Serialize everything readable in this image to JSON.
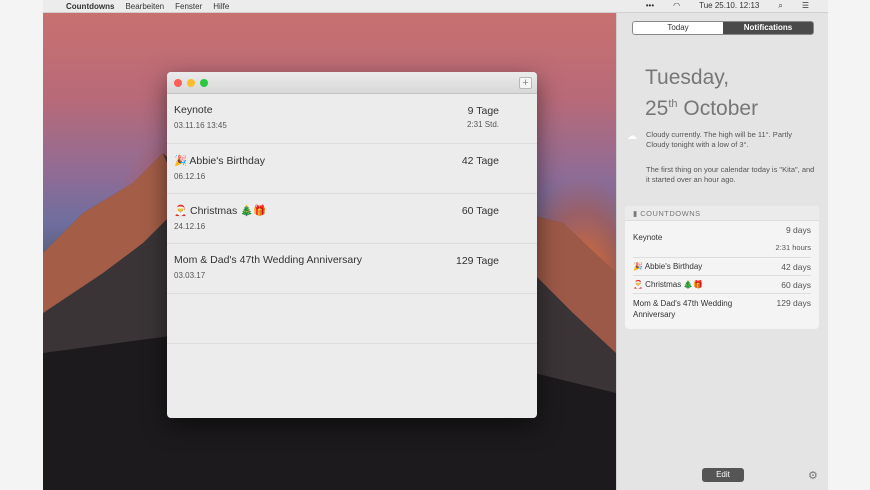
{
  "menubar": {
    "app": "Countdowns",
    "items": [
      "Bearbeiten",
      "Fenster",
      "Hilfe"
    ],
    "clock": "Tue 25.10. 12:13"
  },
  "window": {
    "rows": [
      {
        "title": "Keynote",
        "date": "03.11.16 13:45",
        "value": "9 Tage",
        "sub": "2:31 Std."
      },
      {
        "title": "🎉 Abbie's Birthday",
        "date": "06.12.16",
        "value": "42 Tage"
      },
      {
        "title": "🎅 Christmas 🎄🎁",
        "date": "24.12.16",
        "value": "60 Tage"
      },
      {
        "title": "Mom & Dad's 47th Wedding Anniversary",
        "date": "03.03.17",
        "value": "129 Tage"
      }
    ]
  },
  "nc": {
    "tabs": [
      "Today",
      "Notifications"
    ],
    "weekday": "Tuesday,",
    "date_num": "25",
    "date_sup": "th",
    "month": "October",
    "weather": "Cloudy currently. The high will be 11°. Partly Cloudy tonight with a low of 3°.",
    "calendar": "The first thing on your calendar today is \"Kita\", and it started over an hour ago.",
    "widget_title": "COUNTDOWNS",
    "widget_rows": [
      {
        "title": "Keynote",
        "value": "9 days",
        "sub": "2:31 hours"
      },
      {
        "title": "🎉 Abbie's Birthday",
        "value": "42 days"
      },
      {
        "title": "🎅 Christmas 🎄🎁",
        "value": "60 days"
      },
      {
        "title": "Mom & Dad's 47th Wedding Anniversary",
        "value": "129 days"
      }
    ],
    "edit": "Edit"
  }
}
